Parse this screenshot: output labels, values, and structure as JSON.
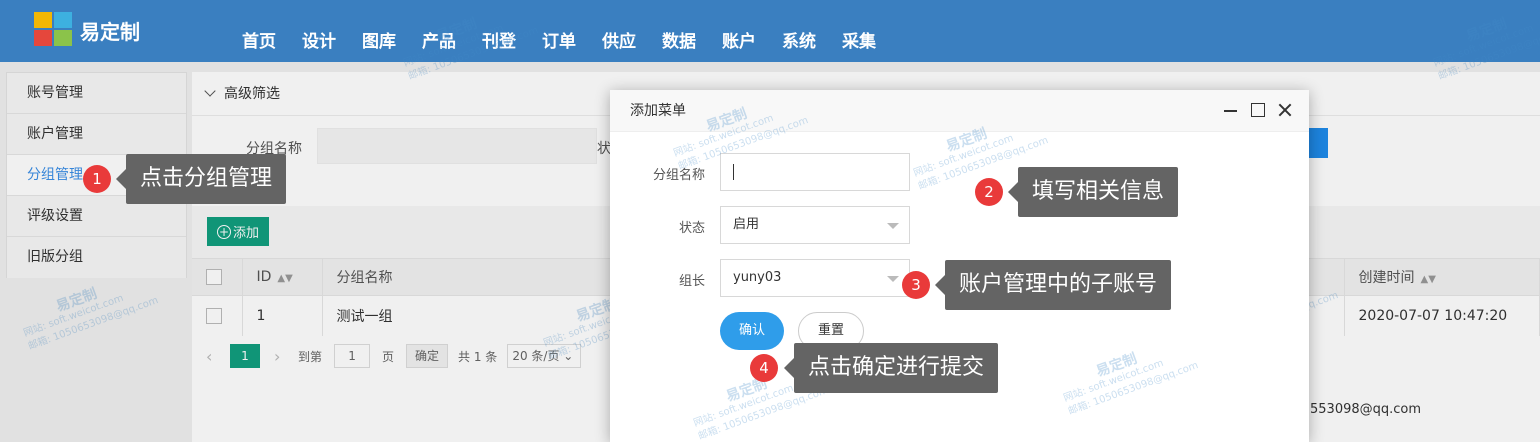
{
  "brand": {
    "name": "易定制"
  },
  "nav": [
    "首页",
    "设计",
    "图库",
    "产品",
    "刊登",
    "订单",
    "供应",
    "数据",
    "账户",
    "系统",
    "采集"
  ],
  "sidebar": {
    "items": [
      {
        "label": "账号管理"
      },
      {
        "label": "账户管理"
      },
      {
        "label": "分组管理"
      },
      {
        "label": "评级设置"
      },
      {
        "label": "旧版分组"
      }
    ]
  },
  "filter": {
    "toggle_label": "高级筛选",
    "group_name_label": "分组名称",
    "status_label_partial": "状"
  },
  "toolbar": {
    "add_label": "添加"
  },
  "table": {
    "headers": {
      "id": "ID",
      "group_name": "分组名称",
      "created_at": "创建时间"
    },
    "rows": [
      {
        "id": "1",
        "group_name": "测试一组",
        "created_at": "2020-07-07 10:47:20"
      }
    ]
  },
  "pager": {
    "current_page": "1",
    "goto_label": "到第",
    "goto_value": "1",
    "page_unit": "页",
    "confirm_label": "确定",
    "total_label": "共 1 条",
    "page_size": "20 条/页"
  },
  "footer": {
    "email_partial": "553098@qq.com"
  },
  "dialog": {
    "title": "添加菜单",
    "group_name_label": "分组名称",
    "group_name_value": "",
    "status_label": "状态",
    "status_value": "启用",
    "leader_label": "组长",
    "leader_value": "yuny03",
    "confirm_label": "确认",
    "reset_label": "重置"
  },
  "callouts": [
    {
      "step": "1",
      "text": "点击分组管理"
    },
    {
      "step": "2",
      "text": "填写相关信息"
    },
    {
      "step": "3",
      "text": "账户管理中的子账号"
    },
    {
      "step": "4",
      "text": "点击确定进行提交"
    }
  ],
  "watermark": {
    "brand": "易定制",
    "site": "网站: soft.weicot.com",
    "mail": "邮箱: 1050653098@qq.com"
  },
  "colors": {
    "topbar": "#3a7fc0",
    "primary_green": "#129f7f",
    "confirm_blue": "#2f9dea",
    "step_red": "#e93a3a",
    "tip_gray": "#646464",
    "active_link": "#3a8ee6"
  }
}
